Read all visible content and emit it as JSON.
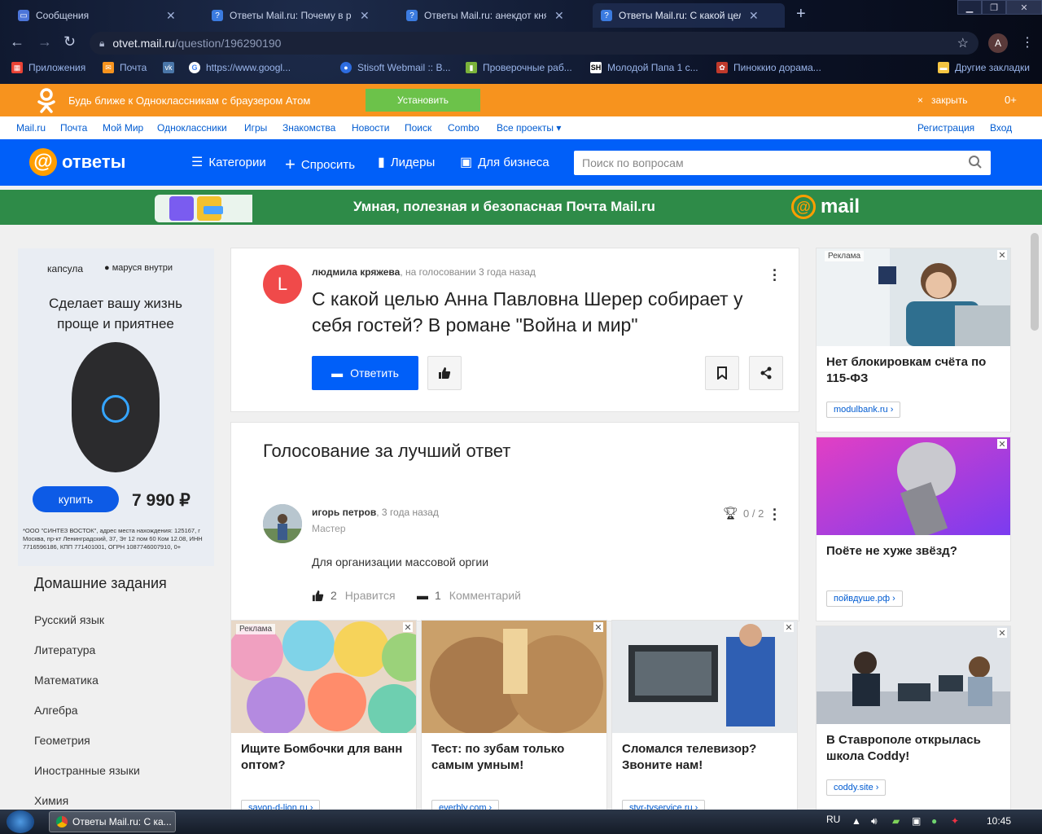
{
  "browser": {
    "tabs": [
      {
        "title": "Сообщения",
        "active": false
      },
      {
        "title": "Ответы Mail.ru: Почему в рома",
        "active": false
      },
      {
        "title": "Ответы Mail.ru: анекдот князя и",
        "active": false
      },
      {
        "title": "Ответы Mail.ru: С какой целью",
        "active": true
      }
    ],
    "url_host": "otvet.mail.ru",
    "url_path": "/question/196290190",
    "profile_initial": "A",
    "bookmarks": [
      {
        "label": "Приложения",
        "color": "#e94235"
      },
      {
        "label": "Почта",
        "color": "#f7931e"
      },
      {
        "label": "",
        "color": "#4a76a8"
      },
      {
        "label": "https://www.googl...",
        "color": "#ffffff"
      },
      {
        "label": "Stisoft Webmail :: В...",
        "color": "#2d6cdf"
      },
      {
        "label": "Проверочные раб...",
        "color": "#7bb33a"
      },
      {
        "label": "Молодой Папа 1 с...",
        "color": "#000000"
      },
      {
        "label": "Пиноккио дорама...",
        "color": "#c0392b"
      },
      {
        "label": "Другие закладки",
        "color": "#f5c542"
      }
    ]
  },
  "ok_banner": {
    "text": "Будь ближе к Одноклассникам с браузером Атом",
    "install": "Установить",
    "close": "закрыть",
    "plus": "0+"
  },
  "portal_nav": {
    "items": [
      "Mail.ru",
      "Почта",
      "Мой Мир",
      "Одноклассники",
      "Игры",
      "Знакомства",
      "Новости",
      "Поиск",
      "Combo",
      "Все проекты ▾"
    ],
    "register": "Регистрация",
    "login": "Вход"
  },
  "header": {
    "logo": "ответы",
    "nav": [
      "Категории",
      "Спросить",
      "Лидеры",
      "Для бизнеса"
    ],
    "search_placeholder": "Поиск по вопросам"
  },
  "promo": {
    "text": "Умная, полезная и безопасная Почта Mail.ru",
    "brand": "mail"
  },
  "left_ad": {
    "brand": "капсула",
    "brand2": "● маруся внутри",
    "headline": "Сделает вашу жизнь проще и приятнее",
    "buy": "купить",
    "price": "7 990 ₽",
    "legal": "*ООО \"СИНТЕЗ ВОСТОК\", адрес места нахождения: 125167, г Москва, пр-кт Ленинградский, 37, Эт 12 пом 60 Ком 12.08, ИНН 7716596186, КПП 771401001, ОГРН 1087746007910, 0+"
  },
  "homework": {
    "title": "Домашние задания",
    "items": [
      "Русский язык",
      "Литература",
      "Математика",
      "Алгебра",
      "Геометрия",
      "Иностранные языки",
      "Химия"
    ]
  },
  "question": {
    "avatar_letter": "L",
    "author": "людмила кряжева",
    "meta": ", на голосовании 3 года назад",
    "title": "С какой целью Анна Павловна Шерер собирает у себя гостей? В романе \"Война и мир\"",
    "answer_btn": "Ответить"
  },
  "voting": {
    "title": "Голосование за лучший ответ"
  },
  "answer": {
    "author": "игорь петров",
    "meta": ", 3 года назад",
    "rank": "Мастер",
    "text": "Для организации массовой оргии",
    "score": "0 / 2",
    "likes_count": "2",
    "likes_label": "Нравится",
    "comments_count": "1",
    "comments_label": "Комментарий"
  },
  "bottom_ads": [
    {
      "tag": "Реклама",
      "title": "Ищите Бомбочки для ванн оптом?",
      "domain": "savon-d-lion.ru ›"
    },
    {
      "tag": "",
      "title": "Тест: по зубам только самым умным!",
      "domain": "everbly.com ›"
    },
    {
      "tag": "",
      "title": "Сломался телевизор? Звоните нам!",
      "domain": "stvr-tvservice.ru ›"
    }
  ],
  "right_ads": [
    {
      "tag": "Реклама",
      "title": "Нет блокировкам счёта по 115-ФЗ",
      "domain": "modulbank.ru ›"
    },
    {
      "tag": "",
      "title": "Поёте не хуже звёзд?",
      "domain": "пойвдуше.рф ›"
    },
    {
      "tag": "",
      "title": "В Ставрополе открылась школа Coddy!",
      "domain": "coddy.site ›"
    }
  ],
  "taskbar": {
    "task": "Ответы Mail.ru: С ка...",
    "lang": "RU",
    "time": "10:45"
  }
}
